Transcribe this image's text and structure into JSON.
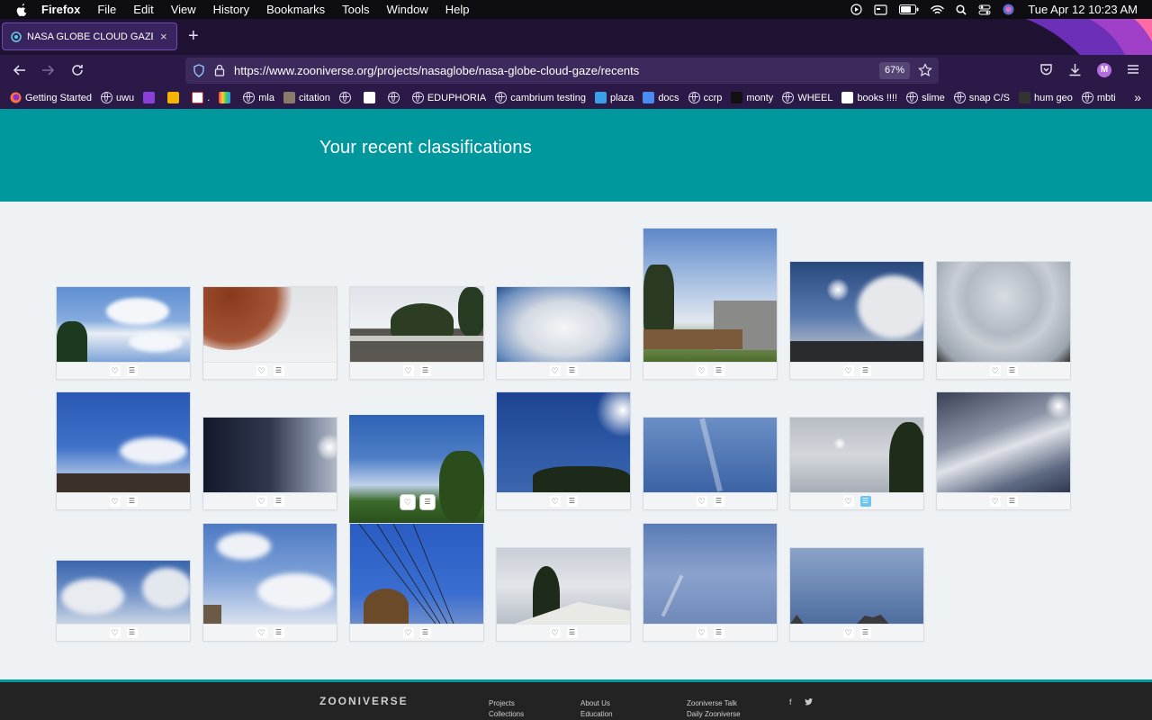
{
  "menubar": {
    "app": "Firefox",
    "items": [
      "File",
      "Edit",
      "View",
      "History",
      "Bookmarks",
      "Tools",
      "Window",
      "Help"
    ],
    "clock": "Tue Apr 12  10:23 AM"
  },
  "tab": {
    "title": "NASA GLOBE CLOUD GAZE — Z",
    "close": "×",
    "new": "+"
  },
  "navbar": {
    "url": "https://www.zooniverse.org/projects/nasaglobe/nasa-globe-cloud-gaze/recents",
    "zoom": "67%",
    "avatar": "M"
  },
  "bookmarks": [
    {
      "label": "Getting Started",
      "icon": "firefox-icon"
    },
    {
      "label": "uwu",
      "icon": "globe-icon"
    },
    {
      "label": "",
      "icon": "s-logo-icon"
    },
    {
      "label": "",
      "icon": "docs-icon"
    },
    {
      "label": ".",
      "icon": "mail-icon"
    },
    {
      "label": "",
      "icon": "color-grid-icon"
    },
    {
      "label": "mla",
      "icon": "globe-icon"
    },
    {
      "label": "citation",
      "icon": "squirrel-icon"
    },
    {
      "label": "",
      "icon": "globe-icon"
    },
    {
      "label": "",
      "icon": "fp-icon"
    },
    {
      "label": "",
      "icon": "globe-icon"
    },
    {
      "label": "EDUPHORIA",
      "icon": "globe-icon"
    },
    {
      "label": "cambrium testing",
      "icon": "globe-icon"
    },
    {
      "label": "plaza",
      "icon": "cloud-icon"
    },
    {
      "label": "docs",
      "icon": "docs-icon"
    },
    {
      "label": "ccrp",
      "icon": "globe-icon"
    },
    {
      "label": "monty",
      "icon": "tiktok-icon"
    },
    {
      "label": "WHEEL",
      "icon": "globe-icon"
    },
    {
      "label": "books !!!!",
      "icon": "v-icon"
    },
    {
      "label": "slime",
      "icon": "globe-icon"
    },
    {
      "label": "snap C/S",
      "icon": "globe-icon"
    },
    {
      "label": "hum geo",
      "icon": "leaf-icon"
    },
    {
      "label": "mbti",
      "icon": "globe-icon"
    }
  ],
  "page": {
    "heading": "Your recent classifications"
  },
  "footer": {
    "logo": "ZOONIVERSE",
    "col1": [
      "Projects",
      "Collections"
    ],
    "col2": [
      "About Us",
      "Education"
    ],
    "col3": [
      "Zooniverse Talk",
      "Daily Zooniverse"
    ],
    "social": [
      "f",
      "twitter"
    ]
  },
  "colors": {
    "teal": "#00979d",
    "tabstrip": "#1f1233",
    "navbar": "#2b1a47"
  }
}
